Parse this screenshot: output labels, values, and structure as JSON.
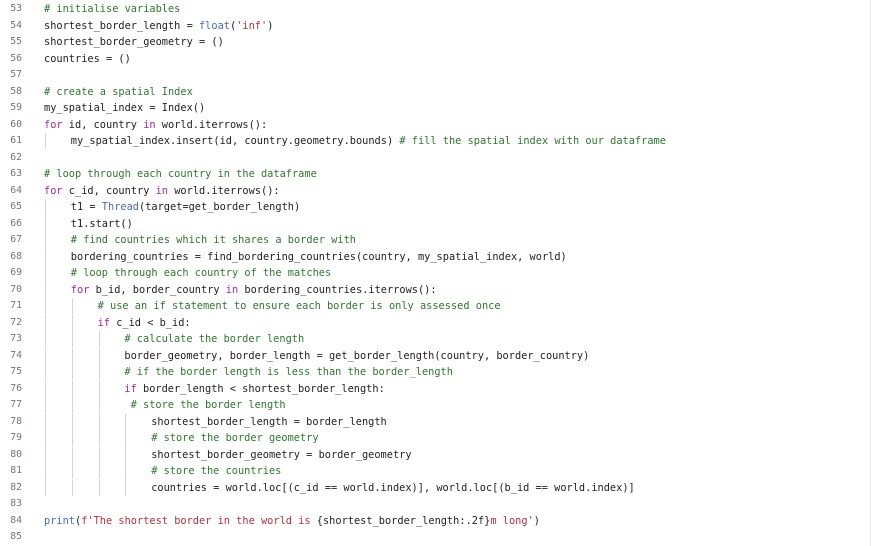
{
  "colors": {
    "background": "#ffffff",
    "line_number": "#6e7681",
    "text": "#1f1f1f",
    "comment": "#2d7a2d",
    "keyword": "#a626a4",
    "string": "#b3343c",
    "builtin": "#4b69c6",
    "indent_guide": "#d4d4d4"
  },
  "editor": {
    "lines": [
      {
        "n": "53",
        "indent": 0,
        "tokens": [
          [
            "comment",
            "# initialise variables"
          ]
        ]
      },
      {
        "n": "54",
        "indent": 0,
        "tokens": [
          [
            "plain",
            "shortest_border_length = "
          ],
          [
            "builtin",
            "float"
          ],
          [
            "plain",
            "("
          ],
          [
            "string",
            "'inf'"
          ],
          [
            "plain",
            ")"
          ]
        ]
      },
      {
        "n": "55",
        "indent": 0,
        "tokens": [
          [
            "plain",
            "shortest_border_geometry = ()"
          ]
        ]
      },
      {
        "n": "56",
        "indent": 0,
        "tokens": [
          [
            "plain",
            "countries = ()"
          ]
        ]
      },
      {
        "n": "57",
        "indent": 0,
        "tokens": []
      },
      {
        "n": "58",
        "indent": 0,
        "tokens": [
          [
            "comment",
            "# create a spatial Index"
          ]
        ]
      },
      {
        "n": "59",
        "indent": 0,
        "tokens": [
          [
            "plain",
            "my_spatial_index = Index()"
          ]
        ]
      },
      {
        "n": "60",
        "indent": 0,
        "tokens": [
          [
            "keyword",
            "for"
          ],
          [
            "plain",
            " id, country "
          ],
          [
            "keyword",
            "in"
          ],
          [
            "plain",
            " world.iterrows():"
          ]
        ]
      },
      {
        "n": "61",
        "indent": 1,
        "tokens": [
          [
            "plain",
            "my_spatial_index.insert(id, country.geometry.bounds) "
          ],
          [
            "comment",
            "# fill the spatial index with our dataframe"
          ]
        ]
      },
      {
        "n": "62",
        "indent": 0,
        "tokens": []
      },
      {
        "n": "63",
        "indent": 0,
        "tokens": [
          [
            "comment",
            "# loop through each country in the dataframe"
          ]
        ]
      },
      {
        "n": "64",
        "indent": 0,
        "tokens": [
          [
            "keyword",
            "for"
          ],
          [
            "plain",
            " c_id, country "
          ],
          [
            "keyword",
            "in"
          ],
          [
            "plain",
            " world.iterrows():"
          ]
        ]
      },
      {
        "n": "65",
        "indent": 1,
        "tokens": [
          [
            "plain",
            "t1 = "
          ],
          [
            "builtin",
            "Thread"
          ],
          [
            "plain",
            "(target=get_border_length)"
          ]
        ]
      },
      {
        "n": "66",
        "indent": 1,
        "tokens": [
          [
            "plain",
            "t1.start()"
          ]
        ]
      },
      {
        "n": "67",
        "indent": 1,
        "tokens": [
          [
            "comment",
            "# find countries which it shares a border with"
          ]
        ]
      },
      {
        "n": "68",
        "indent": 1,
        "tokens": [
          [
            "plain",
            "bordering_countries = find_bordering_countries(country, my_spatial_index, world)"
          ]
        ]
      },
      {
        "n": "69",
        "indent": 1,
        "tokens": [
          [
            "comment",
            "# loop through each country of the matches"
          ]
        ]
      },
      {
        "n": "70",
        "indent": 1,
        "tokens": [
          [
            "keyword",
            "for"
          ],
          [
            "plain",
            " b_id, border_country "
          ],
          [
            "keyword",
            "in"
          ],
          [
            "plain",
            " bordering_countries.iterrows():"
          ]
        ]
      },
      {
        "n": "71",
        "indent": 2,
        "tokens": [
          [
            "comment",
            "# use an if statement to ensure each border is only assessed once"
          ]
        ]
      },
      {
        "n": "72",
        "indent": 2,
        "tokens": [
          [
            "keyword",
            "if"
          ],
          [
            "plain",
            " c_id < b_id:"
          ]
        ]
      },
      {
        "n": "73",
        "indent": 3,
        "tokens": [
          [
            "comment",
            "# calculate the border length"
          ]
        ]
      },
      {
        "n": "74",
        "indent": 3,
        "tokens": [
          [
            "plain",
            "border_geometry, border_length = get_border_length(country, border_country)"
          ]
        ]
      },
      {
        "n": "75",
        "indent": 3,
        "tokens": [
          [
            "comment",
            "# if the border length is less than the border_length"
          ]
        ]
      },
      {
        "n": "76",
        "indent": 3,
        "tokens": [
          [
            "keyword",
            "if"
          ],
          [
            "plain",
            " border_length < shortest_border_length:"
          ]
        ]
      },
      {
        "n": "77",
        "indent": 3,
        "tokens": [
          [
            "plain",
            " "
          ],
          [
            "comment",
            "# store the border length"
          ]
        ]
      },
      {
        "n": "78",
        "indent": 4,
        "tokens": [
          [
            "plain",
            "shortest_border_length = border_length"
          ]
        ]
      },
      {
        "n": "79",
        "indent": 4,
        "tokens": [
          [
            "comment",
            "# store the border geometry"
          ]
        ]
      },
      {
        "n": "80",
        "indent": 4,
        "tokens": [
          [
            "plain",
            "shortest_border_geometry = border_geometry"
          ]
        ]
      },
      {
        "n": "81",
        "indent": 4,
        "tokens": [
          [
            "comment",
            "# store the countries"
          ]
        ]
      },
      {
        "n": "82",
        "indent": 4,
        "tokens": [
          [
            "plain",
            "countries = world.loc[(c_id == world.index)], world.loc[(b_id == world.index)]"
          ]
        ]
      },
      {
        "n": "83",
        "indent": 0,
        "tokens": []
      },
      {
        "n": "84",
        "indent": 0,
        "tokens": [
          [
            "builtin",
            "print"
          ],
          [
            "plain",
            "("
          ],
          [
            "string",
            "f'The shortest border in the world is "
          ],
          [
            "plain",
            "{shortest_border_length:.2f}"
          ],
          [
            "string",
            "m long'"
          ],
          [
            "plain",
            ")"
          ]
        ]
      },
      {
        "n": "85",
        "indent": 0,
        "tokens": []
      }
    ]
  }
}
